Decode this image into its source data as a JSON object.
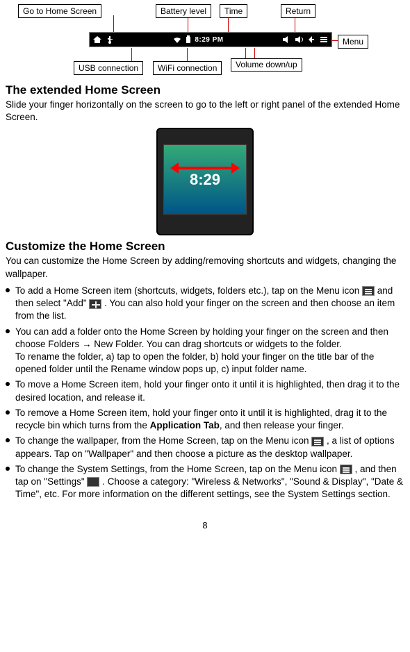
{
  "labels": {
    "go_home": "Go to Home Screen",
    "battery": "Battery level",
    "time": "Time",
    "return": "Return",
    "usb": "USB connection",
    "wifi": "WiFi connection",
    "volume": "Volume down/up",
    "menu": "Menu"
  },
  "statusbar": {
    "time": "8:29 PM"
  },
  "device": {
    "clock": "8:29"
  },
  "h1": "The extended Home Screen",
  "p1": "Slide your finger horizontally on the screen to go to the left or right panel of the extended Home Screen.",
  "h2": "Customize the Home Screen",
  "p2": "You can customize the Home Screen by adding/removing shortcuts and widgets, changing the wallpaper.",
  "b1a": "To add a Home Screen item (shortcuts, widgets, folders etc.), tap on the Menu icon ",
  "b1b": " and then select \"Add\" ",
  "b1c": ". You can also hold your finger on the screen and then choose an item from the list.",
  "b2a": "You can add a folder onto the Home Screen by holding your finger on the screen and then choose Folders → New Folder. You can drag shortcuts or widgets to the folder.",
  "b2b": "To rename the folder, a) tap to open the folder, b) hold your finger on the title bar of the opened folder until the Rename window pops up, c) input folder name.",
  "b3": "To move a Home Screen item, hold your finger onto it until it is highlighted, then drag it to the desired location, and release it.",
  "b4a": "To remove a Home Screen item, hold your finger onto it until it is highlighted, drag it to the recycle bin which turns from the ",
  "b4bold": "Application Tab",
  "b4b": ", and then release your finger.",
  "b5a": "To change the wallpaper, from the Home Screen, tap on the Menu icon ",
  "b5b": ", a list of options appears. Tap on \"Wallpaper\" and then choose a picture as the desktop wallpaper.",
  "b6a": "To change the System Settings, from the Home Screen, tap on the Menu icon ",
  "b6b": ", and then tap on \"Settings\" ",
  "b6c": ". Choose a category: \"Wireless & Networks\", \"Sound & Display\", \"Date & Time\", etc. For more information on the different settings, see the System Settings section.",
  "page_number": "8"
}
